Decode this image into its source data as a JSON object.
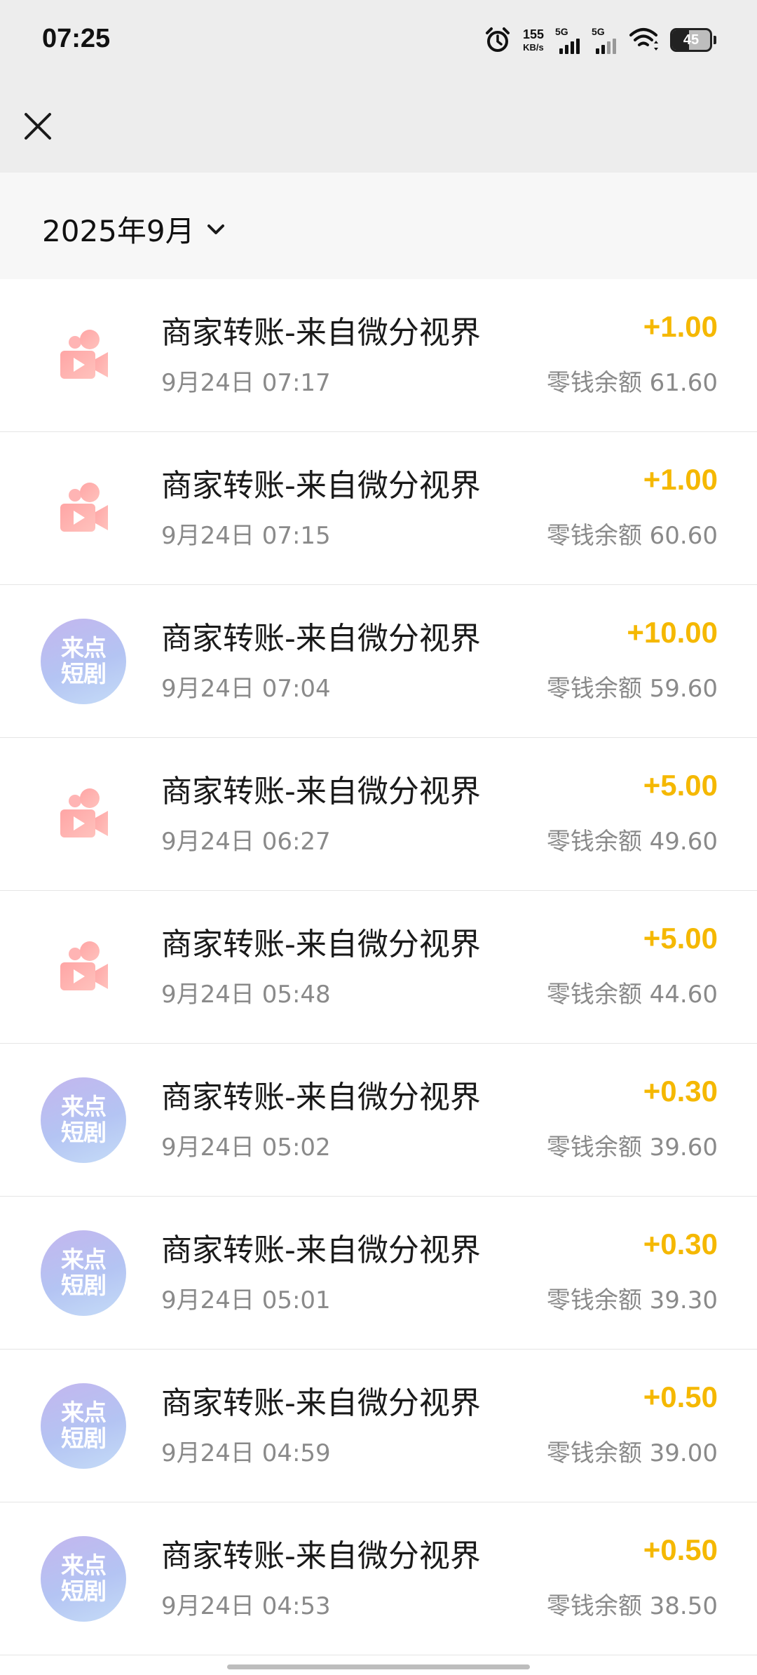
{
  "status_bar": {
    "time": "07:25",
    "net_speed": "155",
    "net_unit": "KB/s",
    "signal_1": "5G",
    "signal_2": "5G",
    "battery_level": "45"
  },
  "header": {
    "month": "2025年9月"
  },
  "colors": {
    "amount": "#f5b800",
    "secondary_text": "#8a8a8a",
    "header_bg": "#ededed"
  },
  "transactions": [
    {
      "title": "商家转账-来自微分视界",
      "time": "9月24日 07:17",
      "amount": "+1.00",
      "balance": "零钱余额 61.60",
      "icon": "video-camera-icon"
    },
    {
      "title": "商家转账-来自微分视界",
      "time": "9月24日 07:15",
      "amount": "+1.00",
      "balance": "零钱余额 60.60",
      "icon": "video-camera-icon"
    },
    {
      "title": "商家转账-来自微分视界",
      "time": "9月24日 07:04",
      "amount": "+10.00",
      "balance": "零钱余额 59.60",
      "icon": "laidian-duanju-logo",
      "logo_line1": "来点",
      "logo_line2": "短剧"
    },
    {
      "title": "商家转账-来自微分视界",
      "time": "9月24日 06:27",
      "amount": "+5.00",
      "balance": "零钱余额 49.60",
      "icon": "video-camera-icon"
    },
    {
      "title": "商家转账-来自微分视界",
      "time": "9月24日 05:48",
      "amount": "+5.00",
      "balance": "零钱余额 44.60",
      "icon": "video-camera-icon"
    },
    {
      "title": "商家转账-来自微分视界",
      "time": "9月24日 05:02",
      "amount": "+0.30",
      "balance": "零钱余额 39.60",
      "icon": "laidian-duanju-logo",
      "logo_line1": "来点",
      "logo_line2": "短剧"
    },
    {
      "title": "商家转账-来自微分视界",
      "time": "9月24日 05:01",
      "amount": "+0.30",
      "balance": "零钱余额 39.30",
      "icon": "laidian-duanju-logo",
      "logo_line1": "来点",
      "logo_line2": "短剧"
    },
    {
      "title": "商家转账-来自微分视界",
      "time": "9月24日 04:59",
      "amount": "+0.50",
      "balance": "零钱余额 39.00",
      "icon": "laidian-duanju-logo",
      "logo_line1": "来点",
      "logo_line2": "短剧"
    },
    {
      "title": "商家转账-来自微分视界",
      "time": "9月24日 04:53",
      "amount": "+0.50",
      "balance": "零钱余额 38.50",
      "icon": "laidian-duanju-logo",
      "logo_line1": "来点",
      "logo_line2": "短剧"
    }
  ]
}
